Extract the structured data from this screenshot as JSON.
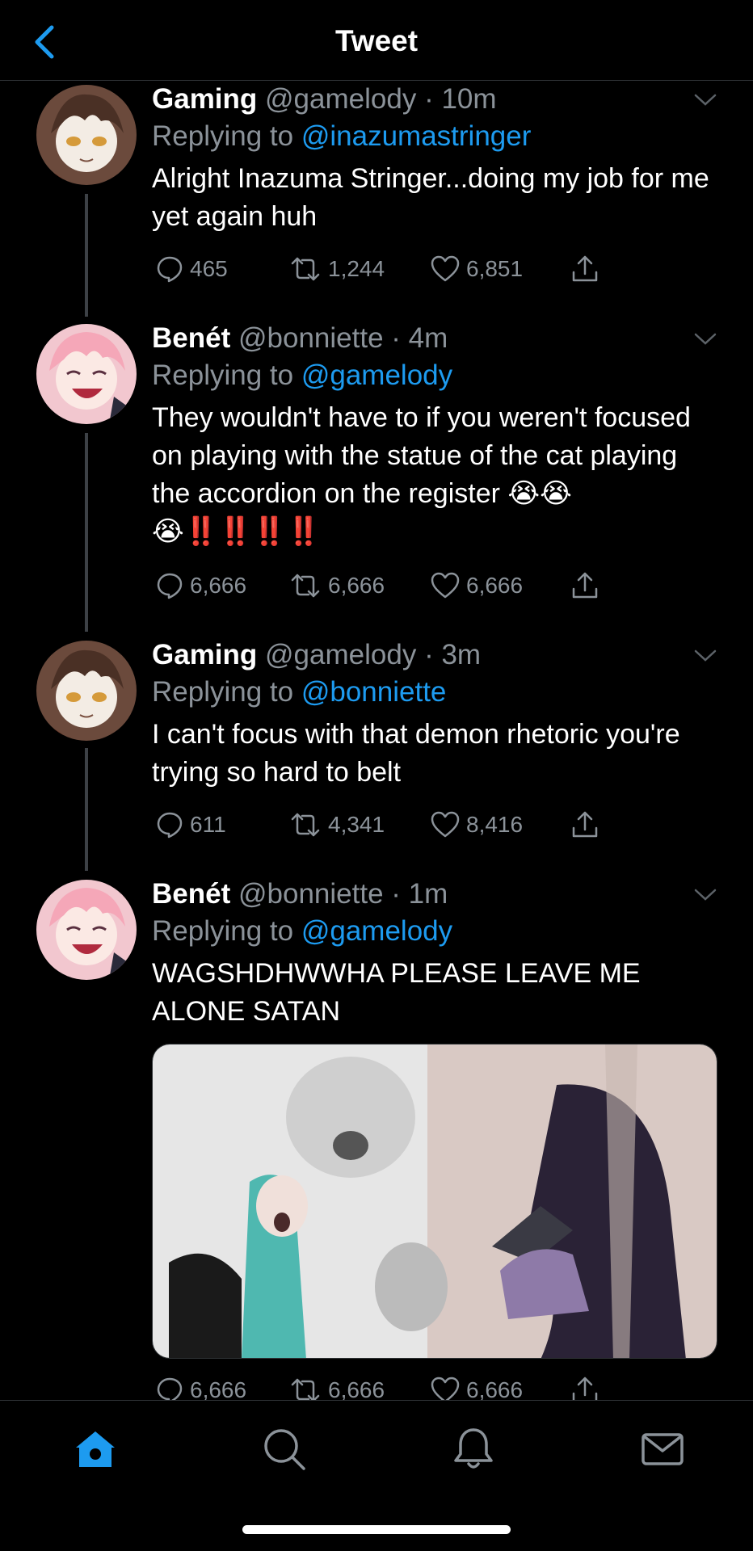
{
  "header": {
    "title": "Tweet"
  },
  "icons": {
    "back": "chevron-left-icon",
    "more": "chevron-down-icon",
    "reply": "reply-icon",
    "retweet": "retweet-icon",
    "like": "heart-icon",
    "share": "share-icon"
  },
  "colors": {
    "accent": "#1d9bf0",
    "muted": "#8b9299",
    "background": "#000000"
  },
  "tweets": [
    {
      "name": "Gaming",
      "handle": "@gamelody",
      "time": "· 10m",
      "replying_label": "Replying to",
      "replying_to": "@inazumastringer",
      "text": "Alright Inazuma Stringer...doing my job for me yet again huh",
      "replies": "465",
      "retweets": "1,244",
      "likes": "6,851"
    },
    {
      "name": "Benét",
      "handle": "@bonniette",
      "time": "· 4m",
      "replying_label": "Replying to",
      "replying_to": "@gamelody",
      "text": "They wouldn't have to if you weren't focused on playing with the statue of the cat playing the accordion on the register 😭😭😭‼️‼️‼️‼️",
      "replies": "6,666",
      "retweets": "6,666",
      "likes": "6,666"
    },
    {
      "name": "Gaming",
      "handle": "@gamelody",
      "time": "· 3m",
      "replying_label": "Replying to",
      "replying_to": "@bonniette",
      "text": "I can't focus with that demon rhetoric you're trying so hard to belt",
      "replies": "611",
      "retweets": "4,341",
      "likes": "8,416"
    },
    {
      "name": "Benét",
      "handle": "@bonniette",
      "time": "· 1m",
      "replying_label": "Replying to",
      "replying_to": "@gamelody",
      "text": "WAGSHDHWWHA PLEASE LEAVE ME ALONE SATAN",
      "replies": "6,666",
      "retweets": "6,666",
      "likes": "6,666"
    }
  ],
  "tabbar": {
    "items": [
      "home-icon",
      "search-icon",
      "notifications-icon",
      "messages-icon"
    ]
  }
}
